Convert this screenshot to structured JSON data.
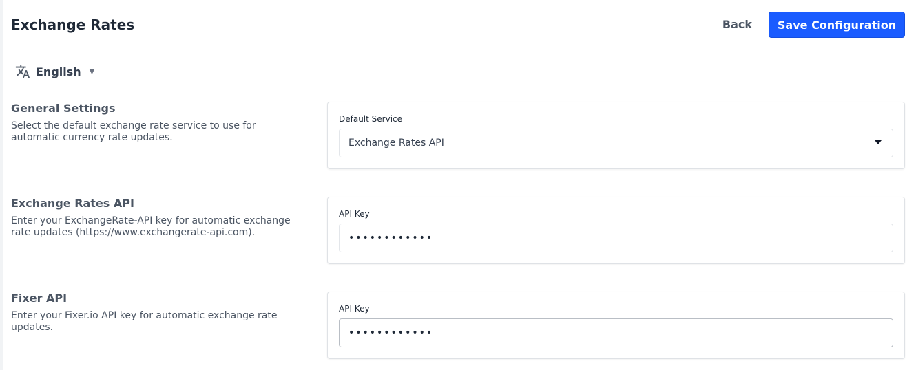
{
  "header": {
    "title": "Exchange Rates",
    "back_label": "Back",
    "save_label": "Save Configuration"
  },
  "language": {
    "selected": "English",
    "icon": "translate-icon"
  },
  "sections": [
    {
      "title": "General Settings",
      "description": "Select the default exchange rate service to use for automatic currency rate updates.",
      "field_label": "Default Service",
      "field_value": "Exchange Rates API"
    },
    {
      "title": "Exchange Rates API",
      "description": "Enter your ExchangeRate-API key for automatic exchange rate updates (https://www.exchangerate-api.com).",
      "field_label": "API Key",
      "field_value": "••••••••••••"
    },
    {
      "title": "Fixer API",
      "description": "Enter your Fixer.io API key for automatic exchange rate updates.",
      "field_label": "API Key",
      "field_value": "••••••••••••"
    }
  ],
  "colors": {
    "primary": "#1a5cff",
    "text": "#1f2937",
    "muted": "#4b5563",
    "border": "#dfe2e6"
  }
}
